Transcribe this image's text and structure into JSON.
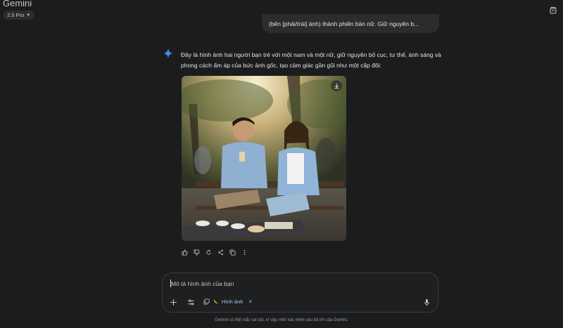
{
  "header": {
    "app_title": "Gemini",
    "model_label": "2.5 Pro",
    "top_right_icon": "temporary-chat-icon"
  },
  "conversation": {
    "user_message": "(bên [phải/trái] ảnh) thành phiên bản nữ. Giữ nguyên b...",
    "response_text": "Đây là hình ảnh hai người bạn trẻ với một nam và một nữ, giữ nguyên bố cục, tư thế, ánh sáng và phong cách ấm áp của bức ảnh gốc, tạo cảm giác gần gũi như một cặp đôi:",
    "image_alt": "generated-image",
    "response_actions": [
      "thumb-up-icon",
      "thumb-down-icon",
      "regenerate-icon",
      "share-icon",
      "copy-icon",
      "more-vert-icon"
    ]
  },
  "composer": {
    "placeholder": "Mô tả hình ảnh của bạn",
    "tool_chip_label": "Hình ảnh",
    "chip_remove": "×"
  },
  "footer": {
    "disclaimer": "Gemini có thể mắc sai sót, vì vậy, nhớ xác minh câu trả lời của Gemini."
  },
  "colors": {
    "background": "#1b1c1d",
    "surface": "#2b2c2e",
    "accent": "#a8c7fa",
    "text": "#e3e3e3"
  }
}
